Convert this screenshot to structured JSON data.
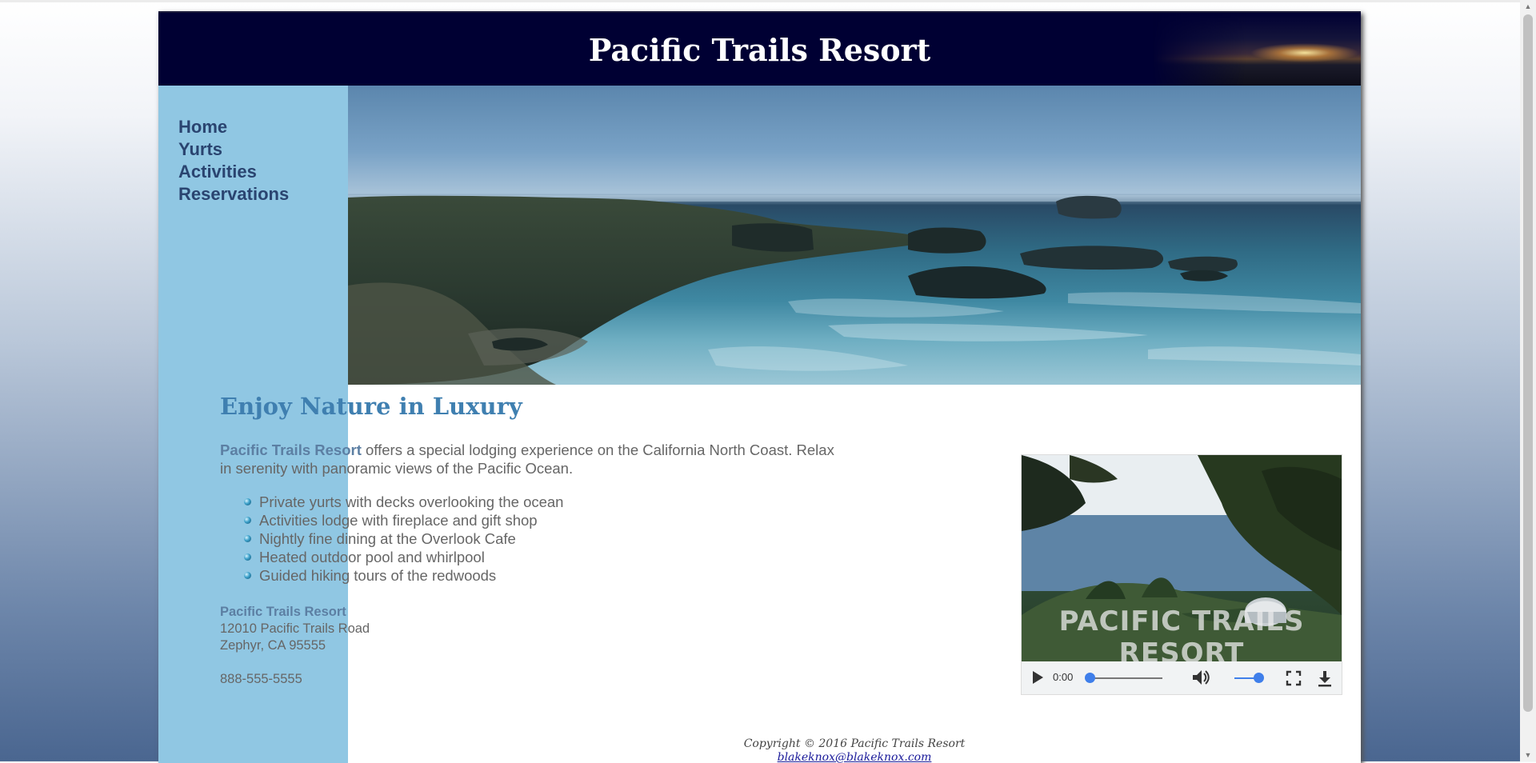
{
  "site": {
    "title": "Pacific Trails Resort"
  },
  "nav": {
    "items": [
      {
        "label": "Home"
      },
      {
        "label": "Yurts"
      },
      {
        "label": "Activities"
      },
      {
        "label": "Reservations"
      }
    ]
  },
  "main": {
    "heading": "Enjoy Nature in Luxury",
    "intro_name": "Pacific Trails Resort",
    "intro_text": " offers a special lodging experience on the California North Coast. Relax in serenity with panoramic views of the Pacific Ocean.",
    "features": [
      "Private yurts with decks overlooking the ocean",
      "Activities lodge with fireplace and gift shop",
      "Nightly fine dining at the Overlook Cafe",
      "Heated outdoor pool and whirlpool",
      "Guided hiking tours of the redwoods"
    ],
    "contact": {
      "name": "Pacific Trails Resort",
      "street": "12010 Pacific Trails Road",
      "city": "Zephyr, CA 95555",
      "phone": "888-555-5555"
    }
  },
  "video": {
    "watermark": "PACIFIC TRAILS RESORT",
    "time": "0:00",
    "progress": 0,
    "volume": 1.0
  },
  "footer": {
    "copyright": "Copyright © 2016 Pacific Trails Resort",
    "email": "blakeknox@blakeknox.com"
  },
  "colors": {
    "header_bg": "#000033",
    "sidebar_bg": "#90c7e3",
    "nav_link": "#2a4470",
    "heading": "#3f7fb0",
    "text": "#666666",
    "accent_name": "#5c7fa3",
    "control_accent": "#3f7fea"
  },
  "icons": [
    "play-icon",
    "volume-icon",
    "fullscreen-icon",
    "download-icon",
    "bullet-icon"
  ]
}
